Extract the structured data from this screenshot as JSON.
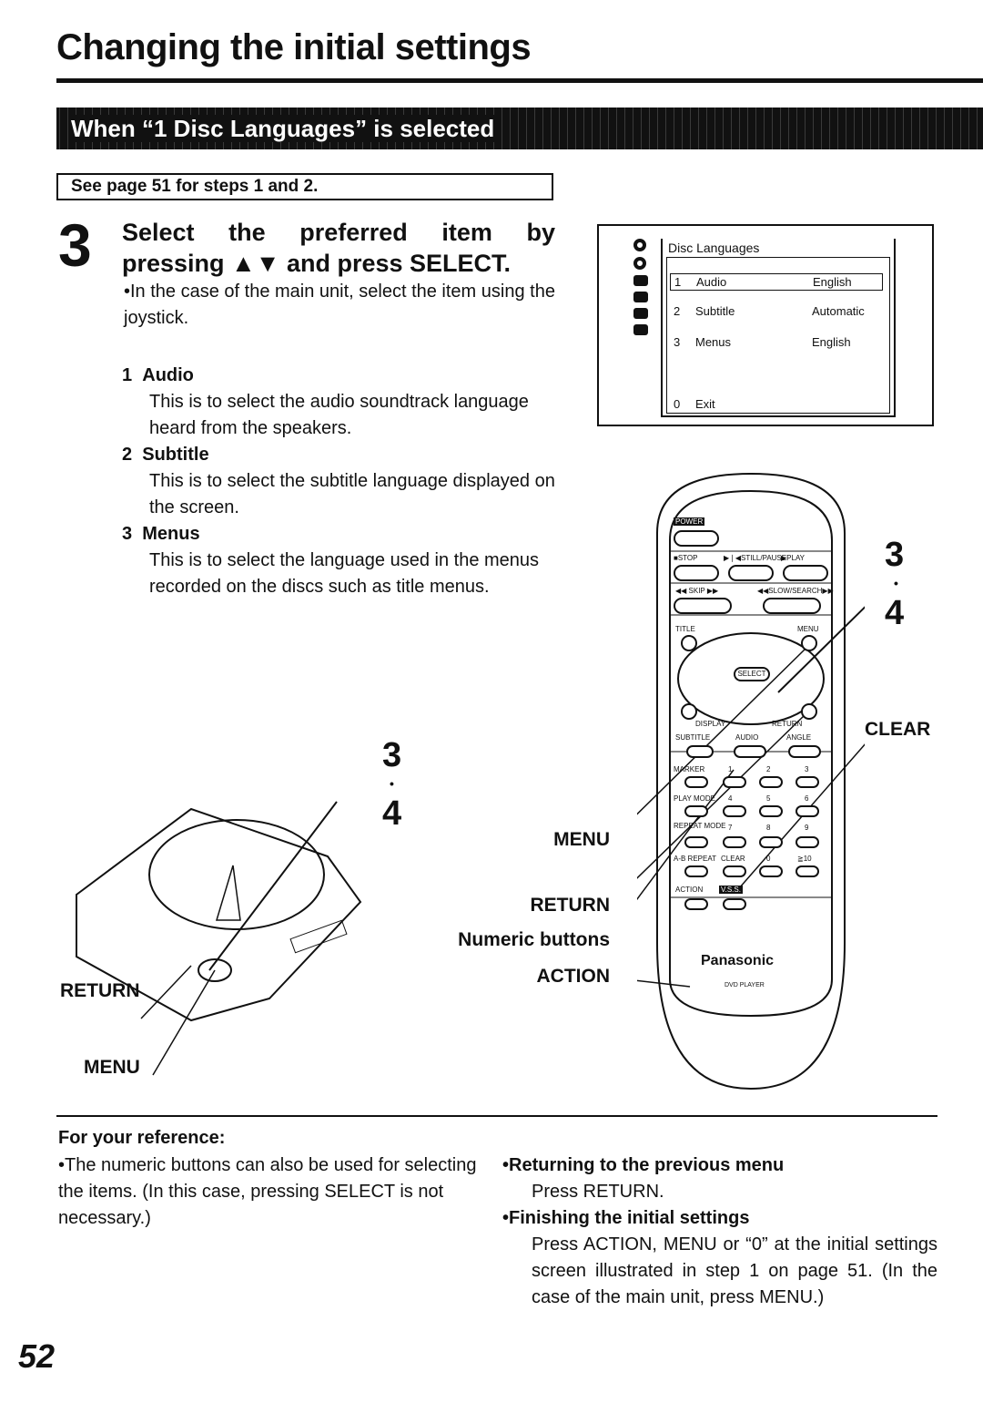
{
  "page": {
    "title": "Changing the initial settings",
    "banner": "When “1 Disc Languages” is selected",
    "see_page": "See page 51 for steps 1 and 2.",
    "page_number": "52"
  },
  "step": {
    "number": "3",
    "heading_words": [
      "Select",
      "the",
      "preferred",
      "item",
      "by"
    ],
    "heading_line2": "pressing ▲▼ and press SELECT.",
    "note": "•In the case of the main unit, select the item using the joystick.",
    "items": [
      {
        "num": "1",
        "label": "Audio",
        "desc": "This is to select the audio soundtrack language heard from the speakers."
      },
      {
        "num": "2",
        "label": "Subtitle",
        "desc": "This is to select the subtitle language displayed on the screen."
      },
      {
        "num": "3",
        "label": "Menus",
        "desc": "This is to select the language used in the menus recorded on the discs such as title menus."
      }
    ]
  },
  "osd": {
    "title": "Disc Languages",
    "rows": [
      {
        "num": "1",
        "label": "Audio",
        "value": "English",
        "selected": true
      },
      {
        "num": "2",
        "label": "Subtitle",
        "value": "Automatic"
      },
      {
        "num": "3",
        "label": "Menus",
        "value": "English"
      },
      {
        "num": "0",
        "label": "Exit",
        "value": ""
      }
    ]
  },
  "remote": {
    "labels": {
      "power": "POWER",
      "stop": "■STOP",
      "still": "▶❘◀STILL/PAUSE",
      "play": "▶PLAY",
      "skip": "◀◀ SKIP ▶▶",
      "search": "◀◀SLOW/SEARCH▶▶",
      "title": "TITLE",
      "menu": "MENU",
      "select": "SELECT",
      "display": "DISPLAY",
      "return": "RETURN",
      "subtitle": "SUBTITLE",
      "audio": "AUDIO",
      "angle": "ANGLE",
      "marker": "MARKER",
      "play_mode": "PLAY MODE",
      "repeat_mode": "REPEAT MODE",
      "ab_repeat": "A-B REPEAT",
      "clear": "CLEAR",
      "action": "ACTION",
      "vss": "V.S.S.",
      "n1": "1",
      "n2": "2",
      "n3": "3",
      "n4": "4",
      "n5": "5",
      "n6": "6",
      "n7": "7",
      "n8": "8",
      "n9": "9",
      "n0": "0",
      "n10": "≧10",
      "brand": "Panasonic",
      "model": "DVD PLAYER"
    }
  },
  "callouts": {
    "remote_step": "3",
    "remote_step2": "4",
    "clear": "CLEAR",
    "menu": "MENU",
    "return": "RETURN",
    "numeric": "Numeric buttons",
    "action": "ACTION",
    "unit_step": "3",
    "unit_step2": "4",
    "unit_return": "RETURN",
    "unit_menu": "MENU"
  },
  "reference": {
    "heading": "For your reference:",
    "left": "•The numeric buttons can also be used for selecting the items. (In this case, pressing SELECT is not necessary.)",
    "right": [
      {
        "head": "•Returning to the previous menu",
        "body": "Press RETURN."
      },
      {
        "head": "•Finishing the initial settings",
        "body": "Press ACTION, MENU or “0” at the initial settings screen illustrated in step 1 on page 51. (In the case of the main unit, press MENU.)"
      }
    ]
  }
}
